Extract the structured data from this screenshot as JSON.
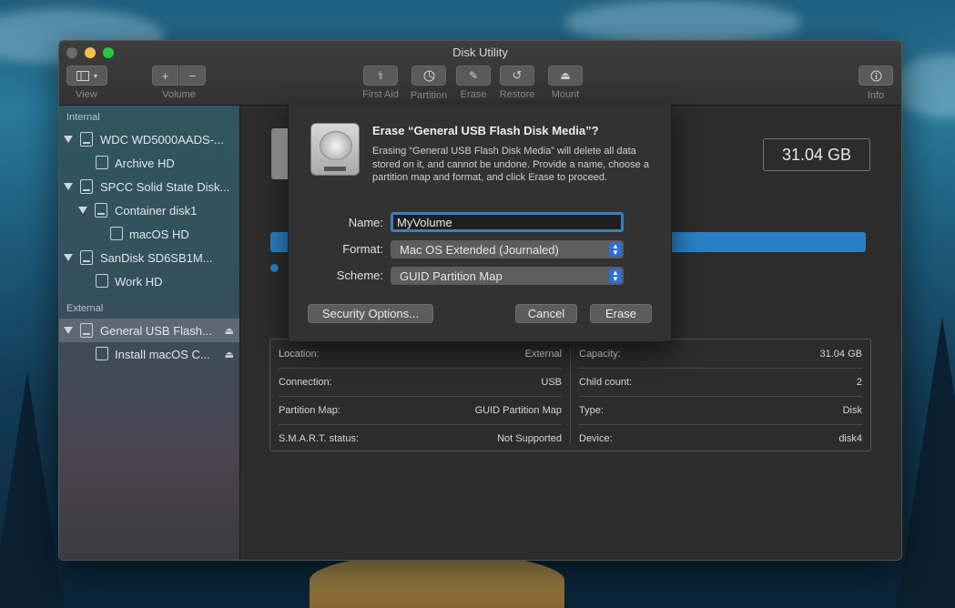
{
  "window": {
    "title": "Disk Utility"
  },
  "toolbar": {
    "view_label": "View",
    "volume_label": "Volume",
    "first_aid_label": "First Aid",
    "partition_label": "Partition",
    "erase_label": "Erase",
    "restore_label": "Restore",
    "mount_label": "Mount",
    "info_label": "Info",
    "add_symbol": "+",
    "remove_symbol": "−"
  },
  "sidebar": {
    "internal_header": "Internal",
    "external_header": "External",
    "items": [
      {
        "label": "WDC WD5000AADS-..."
      },
      {
        "label": "Archive HD"
      },
      {
        "label": "SPCC Solid State Disk..."
      },
      {
        "label": "Container disk1"
      },
      {
        "label": "macOS HD"
      },
      {
        "label": "SanDisk SD6SB1M..."
      },
      {
        "label": "Work HD"
      },
      {
        "label": "General USB Flash..."
      },
      {
        "label": "Install macOS C..."
      }
    ],
    "selected_index": 7,
    "eject_glyph": "⏏"
  },
  "main": {
    "capacity_display": "31.04 GB",
    "info": [
      {
        "key": "Location:",
        "value": "External"
      },
      {
        "key": "Capacity:",
        "value": "31.04 GB"
      },
      {
        "key": "Connection:",
        "value": "USB"
      },
      {
        "key": "Child count:",
        "value": "2"
      },
      {
        "key": "Partition Map:",
        "value": "GUID Partition Map"
      },
      {
        "key": "Type:",
        "value": "Disk"
      },
      {
        "key": "S.M.A.R.T. status:",
        "value": "Not Supported"
      },
      {
        "key": "Device:",
        "value": "disk4"
      }
    ]
  },
  "sheet": {
    "title": "Erase “General USB Flash Disk Media”?",
    "message": "Erasing “General USB Flash Disk Media” will delete all data stored on it, and cannot be undone. Provide a name, choose a partition map and format, and click Erase to proceed.",
    "name_label": "Name:",
    "name_value": "MyVolume",
    "format_label": "Format:",
    "format_value": "Mac OS Extended (Journaled)",
    "scheme_label": "Scheme:",
    "scheme_value": "GUID Partition Map",
    "security_button": "Security Options...",
    "cancel_button": "Cancel",
    "erase_button": "Erase"
  },
  "colors": {
    "accent": "#2f6fd6",
    "usage_bar": "#2b7fc4"
  }
}
